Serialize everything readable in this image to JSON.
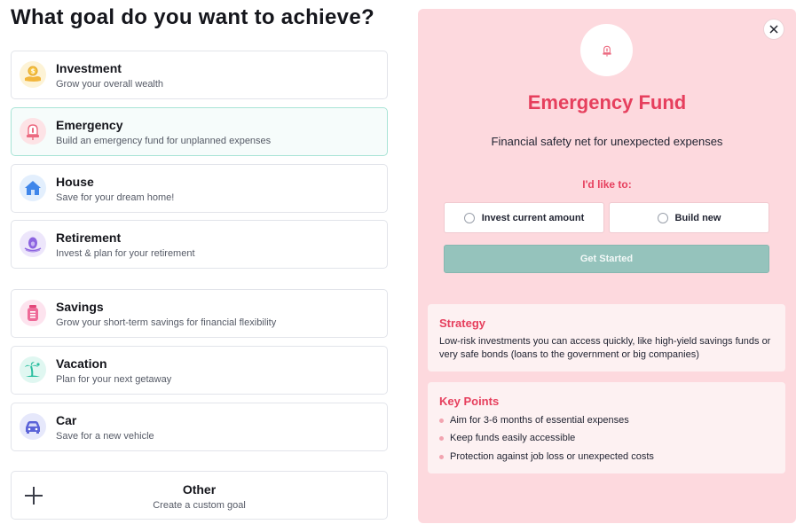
{
  "page": {
    "title": "What goal do you want to achieve?"
  },
  "goals": [
    {
      "title": "Investment",
      "subtitle": "Grow your overall wealth",
      "icon": "coin-hand-icon"
    },
    {
      "title": "Emergency",
      "subtitle": "Build an emergency fund for unplanned expenses",
      "icon": "emergency-siren-icon"
    },
    {
      "title": "House",
      "subtitle": "Save for your dream home!",
      "icon": "house-icon"
    },
    {
      "title": "Retirement",
      "subtitle": "Invest & plan for your retirement",
      "icon": "retirement-nest-egg-icon"
    },
    {
      "title": "Savings",
      "subtitle": "Grow your short-term savings for financial flexibility",
      "icon": "savings-jar-icon"
    },
    {
      "title": "Vacation",
      "subtitle": "Plan for your next getaway",
      "icon": "palm-tree-icon"
    },
    {
      "title": "Car",
      "subtitle": "Save for a new vehicle",
      "icon": "car-icon"
    }
  ],
  "selected_goal": "Emergency",
  "other": {
    "title": "Other",
    "subtitle": "Create a custom goal",
    "icon": "plus-icon"
  },
  "detail": {
    "title": "Emergency Fund",
    "subtitle": "Financial safety net for unexpected expenses",
    "choose_label": "I'd like to:",
    "options": [
      "Invest current amount",
      "Build new"
    ],
    "cta_label": "Get Started",
    "strategy": {
      "title": "Strategy",
      "text": "Low-risk investments you can access quickly, like high-yield savings funds or very safe bonds (loans to the government or big companies)"
    },
    "key_points": {
      "title": "Key Points",
      "items": [
        "Aim for 3-6 months of essential expenses",
        "Keep funds easily accessible",
        "Protection against job loss or unexpected costs"
      ]
    }
  },
  "colors": {
    "accent": "#e63f5d",
    "panel_background": "#fdd9de",
    "cta_background": "#95c3bc",
    "selected_border": "#a9e4d6"
  }
}
